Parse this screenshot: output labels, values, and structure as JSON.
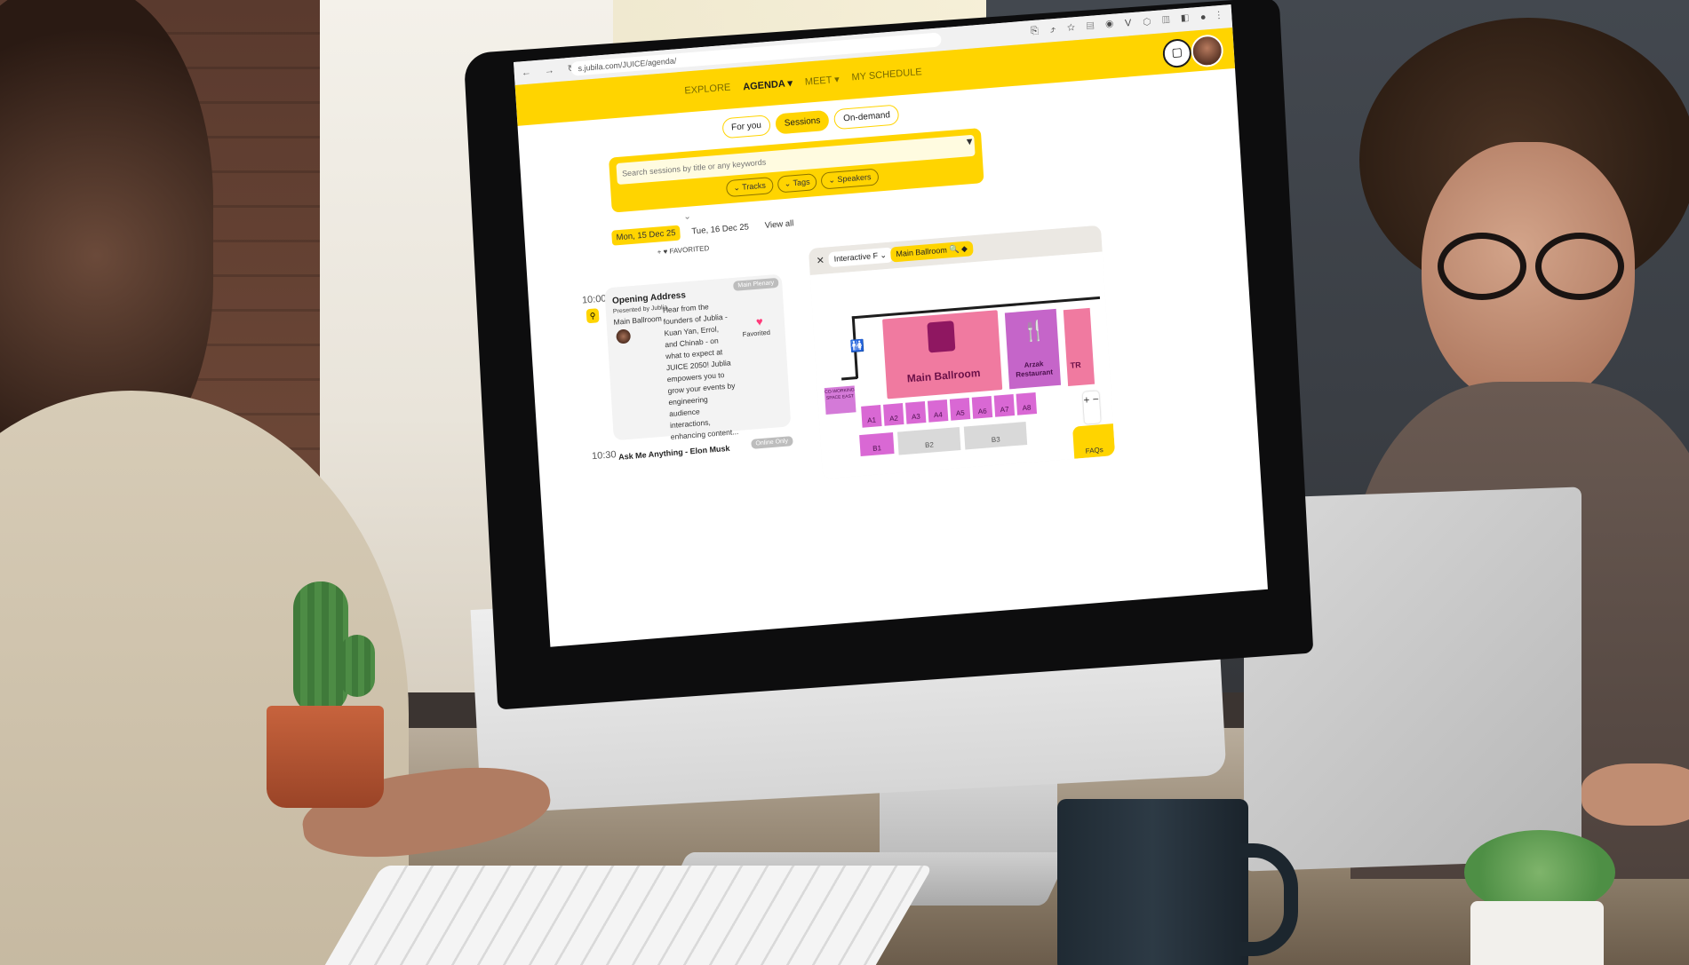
{
  "browser": {
    "nav_glyphs": "← → ↻",
    "url": "s.jubila.com/JUICE/agenda/",
    "extension_glyphs": "⎘ ⤴ ☆ ▤ ◉ V ⬡ ▥ ◧ ● ⋮"
  },
  "appbar": {
    "nav": [
      "EXPLORE",
      "AGENDA ▾",
      "MEET ▾",
      "MY SCHEDULE"
    ],
    "active_index": 1,
    "chat_icon": "chat-bubble-icon",
    "accent": "#ffd400"
  },
  "tabs": [
    "For you",
    "Sessions",
    "On-demand"
  ],
  "selected_tab": "Sessions",
  "search": {
    "placeholder": "Search sessions by title or any keywords",
    "filter_icon": "filter-icon",
    "filters": [
      "⌄ Tracks",
      "⌄ Tags",
      "⌄ Speakers"
    ]
  },
  "expand_glyph": "⌄",
  "dates": [
    "Mon, 15 Dec 25",
    "Tue, 16 Dec 25",
    "View all"
  ],
  "selected_date": "Mon, 15 Dec 25",
  "favorited_filter": "+ ♥ FAVORITED",
  "sessions": [
    {
      "time": "10:00",
      "title": "Opening Address",
      "presenter": "Presented by Jublia",
      "room": "Main Ballroom",
      "description": "Hear from the founders of Jublia - Kuan Yan, Errol, and Chinab - on what to expect at JUICE 2050! Jublia empowers you to grow your events by engineering audience interactions, enhancing content...",
      "badge": "Main Plenary",
      "favorite_label": "Favorited",
      "heart": "♥",
      "pin": "⚲"
    },
    {
      "time": "10:30",
      "title": "Ask Me Anything - Elon Musk",
      "badge": "Online Only"
    }
  ],
  "map": {
    "close": "✕",
    "floor_select": "Interactive F ⌄",
    "location_select": "Main Ballroom 🔍 ◆",
    "restroom_glyph": "🚻",
    "rooms": {
      "ballroom": "Main Ballroom",
      "arzak": "Arzak Restaurant",
      "arzak_glyph": "🍴",
      "tr": "TR",
      "coworking": "CO-WORKING SPACE EAST"
    },
    "booths_row1": [
      "A1",
      "A2",
      "A3",
      "A4",
      "A5",
      "A6",
      "A7",
      "A8"
    ],
    "booths_row2": [
      "B1",
      "B2",
      "B3"
    ],
    "zoom": "+ −",
    "faqs": "FAQs"
  }
}
